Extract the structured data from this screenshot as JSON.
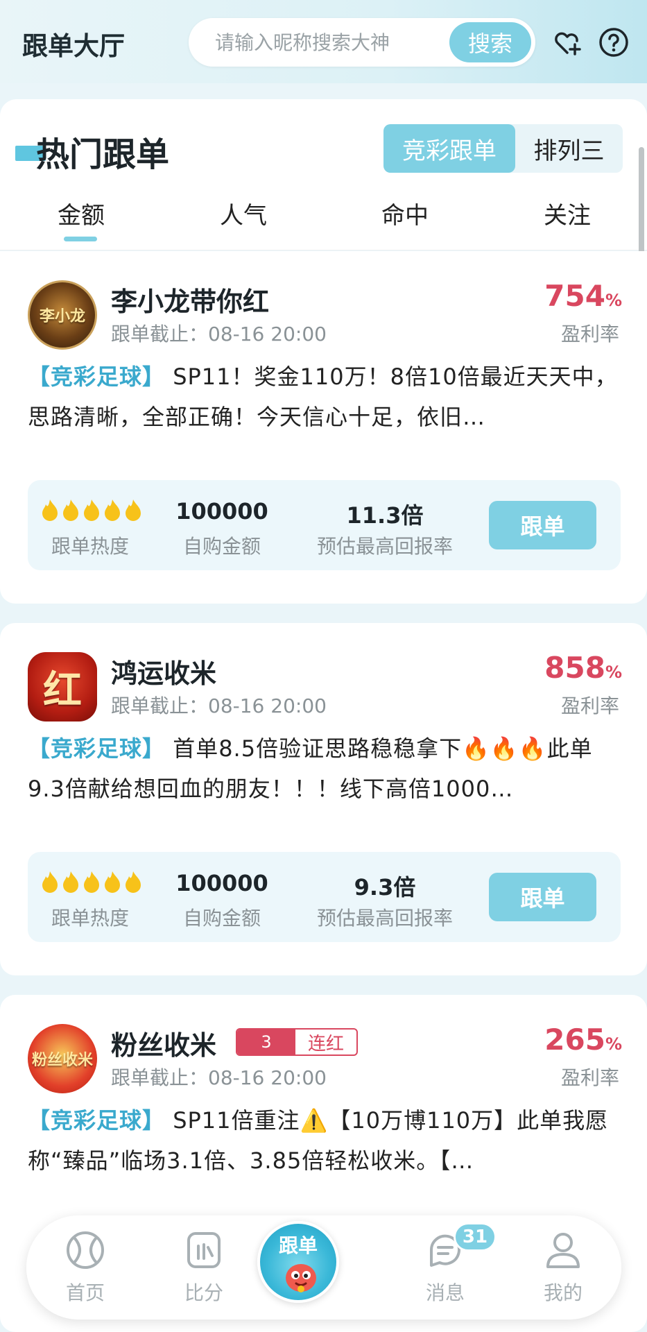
{
  "header": {
    "title": "跟单大厅",
    "search_placeholder": "请输入昵称搜索大神",
    "search_button": "搜索",
    "icons": [
      "heart-plus-icon",
      "help-icon"
    ]
  },
  "hot_section": {
    "title": "热门跟单",
    "type_tabs": [
      {
        "label": "竞彩跟单",
        "active": true
      },
      {
        "label": "排列三",
        "active": false
      }
    ],
    "sort_tabs": [
      {
        "label": "金额",
        "active": true
      },
      {
        "label": "人气",
        "active": false
      },
      {
        "label": "命中",
        "active": false
      },
      {
        "label": "关注",
        "active": false
      }
    ]
  },
  "cards": [
    {
      "name": "李小龙带你红",
      "deadline": "跟单截止：08-16 20:00",
      "profit_rate": "754",
      "profit_unit": "%",
      "profit_label": "盈利率",
      "tag": "【竞彩足球】",
      "description": " SP11！奖金110万！8倍10倍最近天天中，思路清晰，全部正确！今天信心十足，依旧…",
      "heat_label": "跟单热度",
      "heat_level": 5,
      "amount": "100000",
      "amount_label": "自购金额",
      "return_rate": "11.3倍",
      "return_label": "预估最高回报率",
      "follow_button": "跟单",
      "avatar_text": "李小龙"
    },
    {
      "name": "鸿运收米",
      "deadline": "跟单截止：08-16 20:00",
      "profit_rate": "858",
      "profit_unit": "%",
      "profit_label": "盈利率",
      "tag": "【竞彩足球】",
      "description": " 首单8.5倍验证思路稳稳拿下🔥🔥🔥此单9.3倍献给想回血的朋友！！！线下高倍1000…",
      "heat_label": "跟单热度",
      "heat_level": 5,
      "amount": "100000",
      "amount_label": "自购金额",
      "return_rate": "9.3倍",
      "return_label": "预估最高回报率",
      "follow_button": "跟单",
      "avatar_text": "红"
    },
    {
      "name": "粉丝收米",
      "streak_count": "3",
      "streak_label": "连红",
      "deadline": "跟单截止：08-16 20:00",
      "profit_rate": "265",
      "profit_unit": "%",
      "profit_label": "盈利率",
      "tag": "【竞彩足球】",
      "description": " SP11倍重注⚠️【10万博110万】此单我愿称“臻品”临场3.1倍、3.85倍轻松收米。【…",
      "avatar_text": "粉丝收米"
    }
  ],
  "bottom_nav": {
    "items": [
      {
        "label": "首页",
        "icon": "ball-icon"
      },
      {
        "label": "比分",
        "icon": "scoreboard-icon"
      },
      {
        "label": "跟单",
        "icon": "mascot-icon",
        "active": true
      },
      {
        "label": "消息",
        "icon": "message-icon",
        "badge": "31"
      },
      {
        "label": "我的",
        "icon": "profile-icon"
      }
    ]
  },
  "colors": {
    "accent": "#7fd0e3",
    "profit_red": "#d9475f",
    "tag_blue": "#3aa9cd",
    "background": "#eaf5f9"
  }
}
